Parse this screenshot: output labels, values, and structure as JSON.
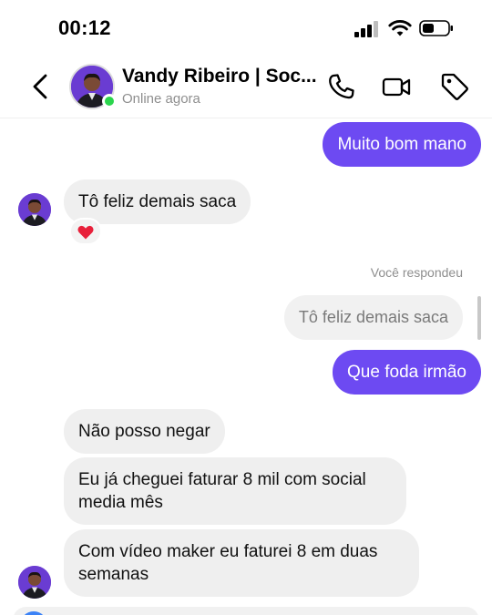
{
  "status_bar": {
    "time": "00:12"
  },
  "header": {
    "contact_name": "Vandy Ribeiro | Soc...",
    "status": "Online agora",
    "icons": [
      "back-chevron-icon",
      "phone-icon",
      "video-call-icon",
      "tag-icon"
    ]
  },
  "messages": [
    {
      "from": "me",
      "text": "Muito bom mano"
    },
    {
      "from": "contact",
      "text": "Tô feliz demais saca",
      "reaction": "heart"
    },
    {
      "from": "me",
      "reply_label": "Você respondeu",
      "quoted_text": "Tô feliz demais saca",
      "text": "Que foda irmão"
    },
    {
      "from": "contact",
      "text": "Não posso negar"
    },
    {
      "from": "contact",
      "text_lines": [
        "Eu já cheguei faturar 8 mil com social",
        "media mês"
      ]
    },
    {
      "from": "contact",
      "text_lines": [
        "Com vídeo maker eu faturei 8 em duas",
        "semanas"
      ]
    }
  ],
  "colors": {
    "outgoing_bubble": "#6d4af2",
    "incoming_bubble": "#efefef",
    "online": "#2bd54d"
  }
}
